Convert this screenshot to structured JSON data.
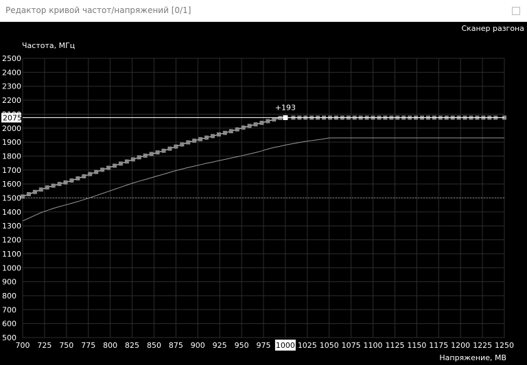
{
  "window": {
    "title": "Редактор кривой частот/напряжений [0/1]",
    "scanner_button": "Сканер разгона"
  },
  "colors": {
    "background": "#000000",
    "grid": "#2e2e2e",
    "curve": "#cfcfcf",
    "point": "#8a8a8a",
    "baseline": "#8a8a8a",
    "highlight": "#ffffff"
  },
  "chart_data": {
    "type": "line",
    "xlabel": "Напряжение, МВ",
    "ylabel": "Частота, МГц",
    "xlim": [
      700,
      1250
    ],
    "ylim": [
      500,
      2500
    ],
    "x_ticks": [
      700,
      725,
      750,
      775,
      800,
      825,
      850,
      875,
      900,
      925,
      950,
      975,
      1000,
      1025,
      1050,
      1075,
      1100,
      1125,
      1150,
      1175,
      1200,
      1225,
      1250
    ],
    "y_ticks": [
      500,
      600,
      700,
      800,
      900,
      1000,
      1100,
      1200,
      1300,
      1400,
      1500,
      1600,
      1700,
      1800,
      1900,
      2000,
      2100,
      2200,
      2300,
      2400,
      2500
    ],
    "grid": true,
    "selected": {
      "x": 1000,
      "y": 2075,
      "x_label": "1000",
      "y_label": "2075",
      "offset_label": "+193"
    },
    "reference_line": {
      "y": 1500,
      "style": "dotted"
    },
    "series": [
      {
        "role": "edited-curve",
        "points": [
          [
            700,
            1510
          ],
          [
            707,
            1527
          ],
          [
            714,
            1543
          ],
          [
            721,
            1560
          ],
          [
            728,
            1575
          ],
          [
            735,
            1588
          ],
          [
            742,
            1600
          ],
          [
            749,
            1611
          ],
          [
            756,
            1625
          ],
          [
            763,
            1640
          ],
          [
            770,
            1655
          ],
          [
            777,
            1671
          ],
          [
            784,
            1686
          ],
          [
            791,
            1702
          ],
          [
            798,
            1716
          ],
          [
            805,
            1731
          ],
          [
            812,
            1746
          ],
          [
            819,
            1761
          ],
          [
            826,
            1776
          ],
          [
            833,
            1791
          ],
          [
            840,
            1803
          ],
          [
            847,
            1815
          ],
          [
            854,
            1826
          ],
          [
            861,
            1838
          ],
          [
            868,
            1853
          ],
          [
            875,
            1868
          ],
          [
            882,
            1883
          ],
          [
            889,
            1898
          ],
          [
            896,
            1910
          ],
          [
            903,
            1921
          ],
          [
            910,
            1932
          ],
          [
            917,
            1943
          ],
          [
            924,
            1955
          ],
          [
            931,
            1966
          ],
          [
            938,
            1978
          ],
          [
            945,
            1991
          ],
          [
            952,
            2004
          ],
          [
            959,
            2016
          ],
          [
            966,
            2027
          ],
          [
            973,
            2038
          ],
          [
            980,
            2050
          ],
          [
            987,
            2062
          ],
          [
            994,
            2073
          ],
          [
            1000,
            2075
          ],
          [
            1009,
            2075
          ],
          [
            1016,
            2075
          ],
          [
            1023,
            2075
          ],
          [
            1030,
            2075
          ],
          [
            1037,
            2075
          ],
          [
            1044,
            2075
          ],
          [
            1051,
            2075
          ],
          [
            1058,
            2075
          ],
          [
            1065,
            2075
          ],
          [
            1072,
            2075
          ],
          [
            1079,
            2075
          ],
          [
            1086,
            2075
          ],
          [
            1093,
            2075
          ],
          [
            1100,
            2075
          ],
          [
            1107,
            2075
          ],
          [
            1114,
            2075
          ],
          [
            1121,
            2075
          ],
          [
            1128,
            2075
          ],
          [
            1135,
            2075
          ],
          [
            1142,
            2075
          ],
          [
            1149,
            2075
          ],
          [
            1156,
            2075
          ],
          [
            1163,
            2075
          ],
          [
            1170,
            2075
          ],
          [
            1177,
            2075
          ],
          [
            1184,
            2075
          ],
          [
            1191,
            2075
          ],
          [
            1198,
            2075
          ],
          [
            1205,
            2075
          ],
          [
            1212,
            2075
          ],
          [
            1219,
            2075
          ],
          [
            1226,
            2075
          ],
          [
            1233,
            2075
          ],
          [
            1240,
            2075
          ],
          [
            1250,
            2075
          ]
        ]
      },
      {
        "role": "default-curve",
        "points": [
          [
            700,
            1335
          ],
          [
            707,
            1355
          ],
          [
            714,
            1375
          ],
          [
            721,
            1395
          ],
          [
            728,
            1410
          ],
          [
            735,
            1425
          ],
          [
            742,
            1438
          ],
          [
            749,
            1450
          ],
          [
            756,
            1462
          ],
          [
            763,
            1474
          ],
          [
            770,
            1488
          ],
          [
            777,
            1502
          ],
          [
            784,
            1517
          ],
          [
            791,
            1532
          ],
          [
            798,
            1547
          ],
          [
            805,
            1562
          ],
          [
            812,
            1577
          ],
          [
            819,
            1592
          ],
          [
            826,
            1607
          ],
          [
            833,
            1620
          ],
          [
            840,
            1632
          ],
          [
            847,
            1645
          ],
          [
            854,
            1658
          ],
          [
            861,
            1670
          ],
          [
            868,
            1683
          ],
          [
            875,
            1696
          ],
          [
            882,
            1707
          ],
          [
            889,
            1718
          ],
          [
            896,
            1728
          ],
          [
            903,
            1738
          ],
          [
            910,
            1748
          ],
          [
            917,
            1757
          ],
          [
            924,
            1767
          ],
          [
            931,
            1776
          ],
          [
            938,
            1786
          ],
          [
            945,
            1795
          ],
          [
            952,
            1805
          ],
          [
            959,
            1815
          ],
          [
            966,
            1825
          ],
          [
            973,
            1837
          ],
          [
            980,
            1850
          ],
          [
            987,
            1862
          ],
          [
            994,
            1870
          ],
          [
            1001,
            1880
          ],
          [
            1008,
            1888
          ],
          [
            1015,
            1896
          ],
          [
            1022,
            1904
          ],
          [
            1029,
            1910
          ],
          [
            1036,
            1916
          ],
          [
            1043,
            1922
          ],
          [
            1050,
            1930
          ],
          [
            1100,
            1930
          ],
          [
            1150,
            1930
          ],
          [
            1200,
            1930
          ],
          [
            1250,
            1930
          ]
        ]
      }
    ]
  }
}
